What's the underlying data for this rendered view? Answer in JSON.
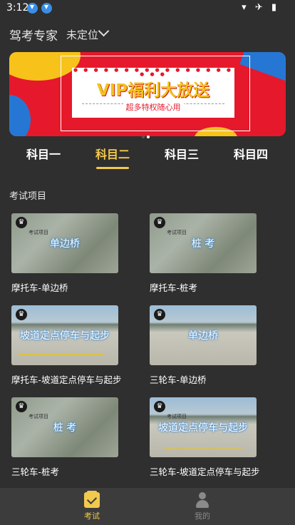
{
  "status": {
    "time": "3:12",
    "icons": "▾ ✈ ▮"
  },
  "header": {
    "brand": "驾考专家",
    "location": "未定位"
  },
  "banner": {
    "title": "VIP福利大放送",
    "subtitle": "超多特权随心用",
    "dots": "● ● ● ● ● ● ● ● ● ● ● ● ● ● ● ● ● ● ●"
  },
  "tabs": [
    {
      "label": "科目一"
    },
    {
      "label": "科目二"
    },
    {
      "label": "科目三"
    },
    {
      "label": "科目四"
    }
  ],
  "active_tab": 1,
  "section": {
    "title": "考试项目"
  },
  "items": [
    {
      "thumb_label": "单边桥",
      "title": "摩托车-单边桥",
      "scene": "grass"
    },
    {
      "thumb_label": "桩 考",
      "title": "摩托车-桩考",
      "scene": "grass"
    },
    {
      "thumb_label": "坡道定点停车与起步",
      "title": "摩托车-坡道定点停车与起步",
      "scene": "lot"
    },
    {
      "thumb_label": "单边桥",
      "title": "三轮车-单边桥",
      "scene": "lot"
    },
    {
      "thumb_label": "桩 考",
      "title": "三轮车-桩考",
      "scene": "grass"
    },
    {
      "thumb_label": "坡道定点停车与起步",
      "title": "三轮车-坡道定点停车与起步",
      "scene": "lot"
    }
  ],
  "thumb_watermark": "考试项目",
  "nav": [
    {
      "label": "考试"
    },
    {
      "label": "我的"
    }
  ],
  "colors": {
    "accent": "#f2c94c",
    "background": "#2f2f2f",
    "banner_red": "#e5192b"
  }
}
